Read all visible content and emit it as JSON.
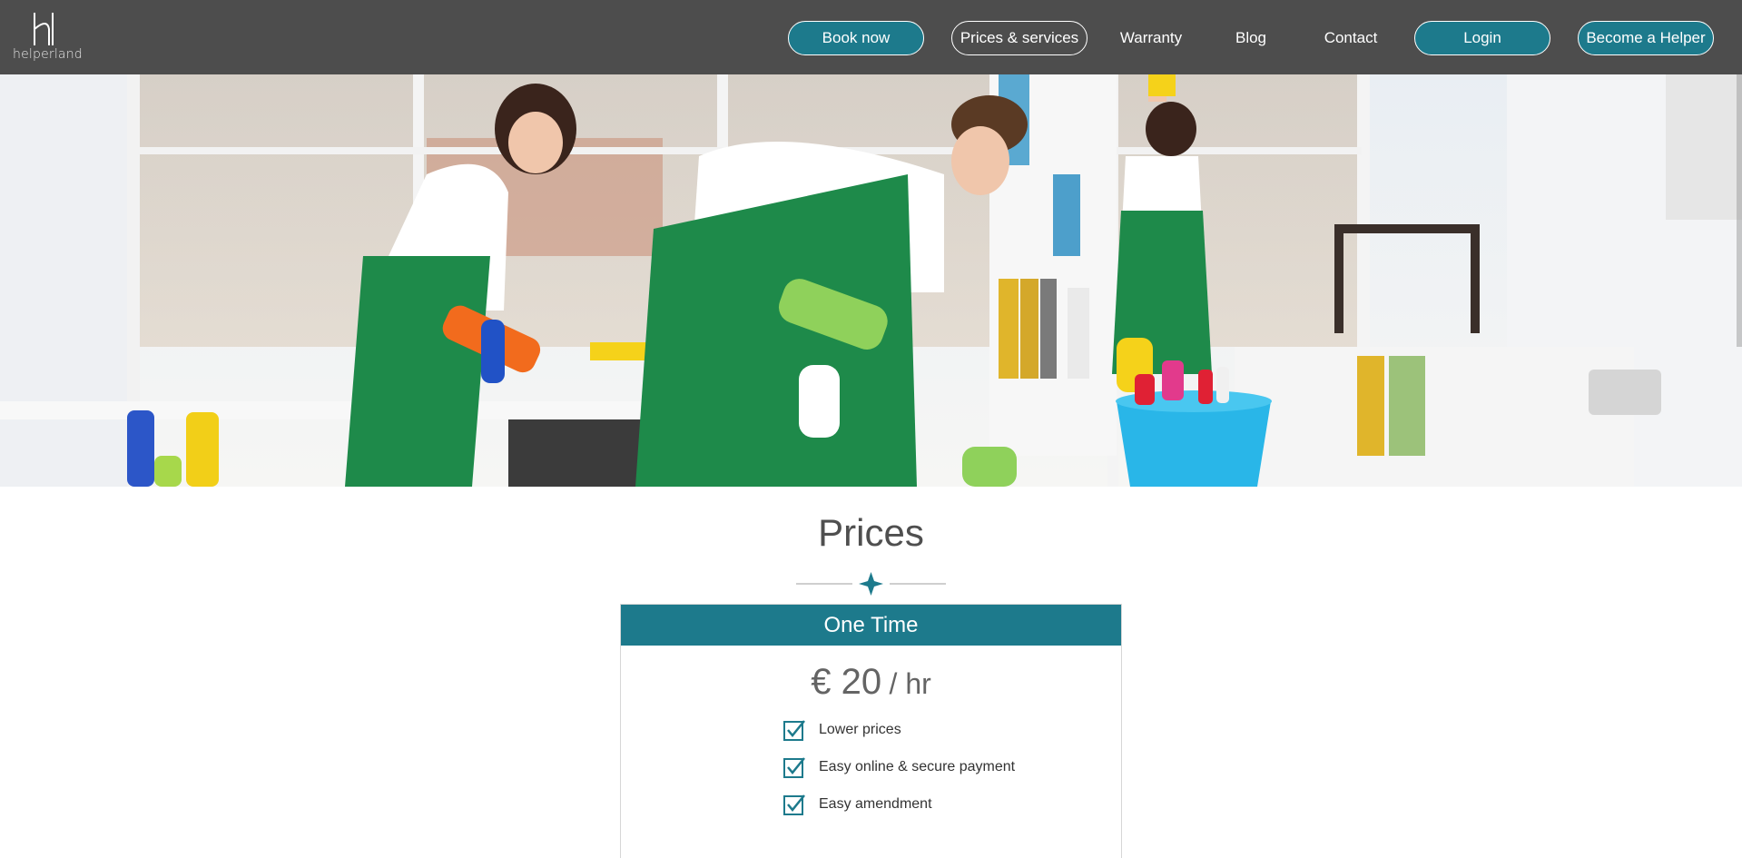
{
  "brand": {
    "name": "helperland"
  },
  "nav": {
    "book_now": "Book now",
    "prices_services": "Prices & services",
    "warranty": "Warranty",
    "blog": "Blog",
    "contact": "Contact",
    "login": "Login",
    "become_helper": "Become a Helper"
  },
  "hero": {
    "image": "cleaning-team-photo"
  },
  "prices": {
    "title": "Prices",
    "card": {
      "heading": "One Time",
      "price_amount": "€ 20",
      "price_unit": "/ hr",
      "features": [
        "Lower prices",
        "Easy online & secure payment",
        "Easy amendment"
      ]
    }
  },
  "colors": {
    "header_bg": "#4d4d4d",
    "accent": "#1d7a8c"
  }
}
